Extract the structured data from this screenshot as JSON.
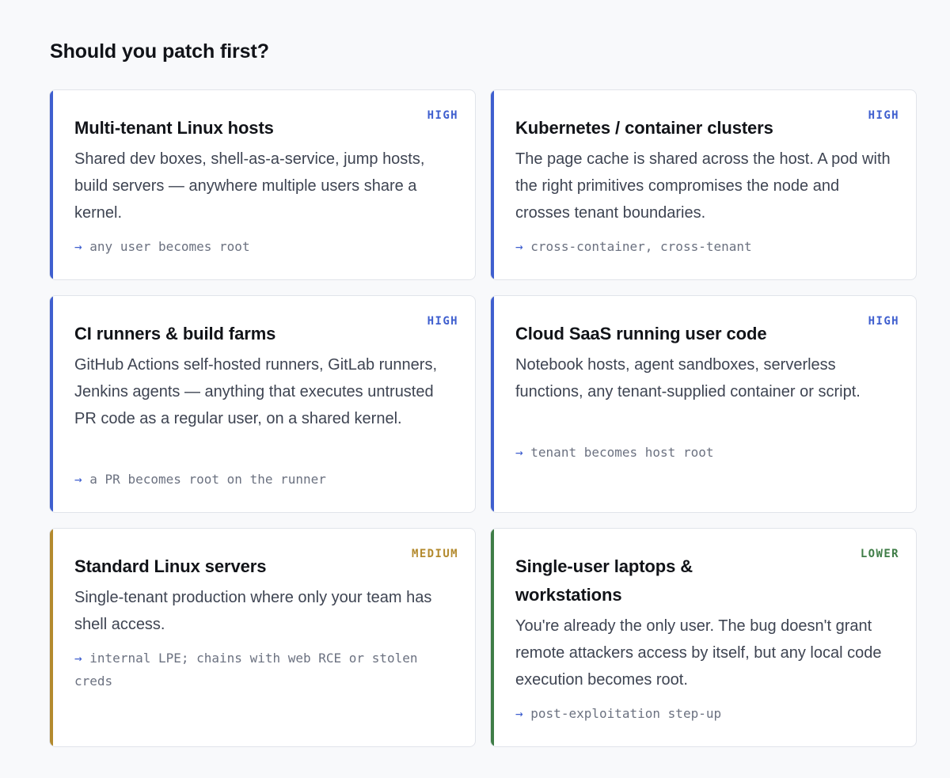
{
  "page": {
    "title": "Should you patch first?"
  },
  "colors": {
    "high": "#3f5fcf",
    "medium": "#b38a2e",
    "lower": "#3f7d47"
  },
  "cards": [
    {
      "title": "Multi-tenant Linux hosts",
      "badge": "HIGH",
      "severity": "high",
      "description": "Shared dev boxes, shell-as-a-service, jump hosts, build servers — anywhere multiple users share a kernel.",
      "arrow": "→",
      "impact": "any user becomes root"
    },
    {
      "title": "Kubernetes / container clusters",
      "badge": "HIGH",
      "severity": "high",
      "description": "The page cache is shared across the host. A pod with the right primitives compromises the node and crosses tenant boundaries.",
      "arrow": "→",
      "impact": "cross-container, cross-tenant"
    },
    {
      "title": "CI runners & build farms",
      "badge": "HIGH",
      "severity": "high",
      "description": "GitHub Actions self-hosted runners, GitLab runners, Jenkins agents — anything that executes untrusted PR code as a regular user, on a shared kernel.",
      "arrow": "→",
      "impact": "a PR becomes root on the runner"
    },
    {
      "title": "Cloud SaaS running user code",
      "badge": "HIGH",
      "severity": "high",
      "description": "Notebook hosts, agent sandboxes, serverless functions, any tenant-supplied container or script.",
      "arrow": "→",
      "impact": "tenant becomes host root"
    },
    {
      "title": "Standard Linux servers",
      "badge": "MEDIUM",
      "severity": "medium",
      "description": "Single-tenant production where only your team has shell access.",
      "arrow": "→",
      "impact": "internal LPE; chains with web RCE or stolen creds"
    },
    {
      "title": "Single-user laptops & workstations",
      "badge": "LOWER",
      "severity": "lower",
      "description": "You're already the only user. The bug doesn't grant remote attackers access by itself, but any local code execution becomes root.",
      "arrow": "→",
      "impact": "post-exploitation step-up"
    }
  ]
}
